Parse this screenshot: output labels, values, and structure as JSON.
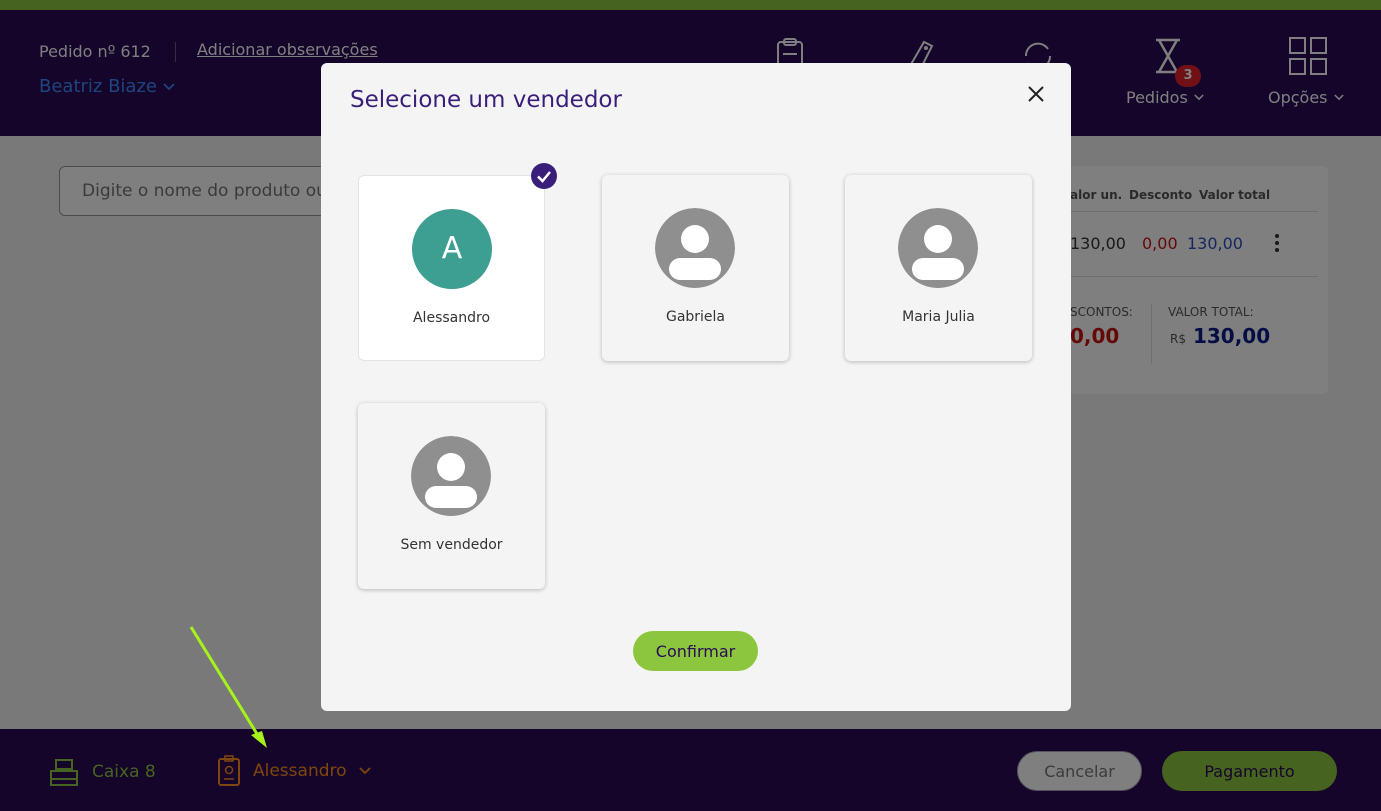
{
  "header": {
    "order_label": "Pedido nº 612",
    "add_notes": "Adicionar observações",
    "customer": "Beatriz Biaze",
    "nav": [
      {
        "label": "Pedidos",
        "icon": "hourglass-icon",
        "badge": "3"
      },
      {
        "label": "Opções",
        "icon": "grid-icon"
      }
    ]
  },
  "search": {
    "placeholder": "Digite o nome do produto ou código"
  },
  "cart": {
    "columns": [
      "alor un.",
      "Desconto",
      "Valor total"
    ],
    "row": {
      "unit": "130,00",
      "discount": "0,00",
      "total": "130,00"
    },
    "discounts_label": "SCONTOS:",
    "discounts_value": "0,00",
    "total_label": "VALOR TOTAL:",
    "currency": "R$",
    "total_value": "130,00"
  },
  "footer": {
    "register": "Caixa 8",
    "seller": "Alessandro",
    "cancel": "Cancelar",
    "payment": "Pagamento"
  },
  "modal": {
    "title": "Selecione um vendedor",
    "sellers": [
      {
        "name": "Alessandro",
        "initial": "A",
        "selected": true
      },
      {
        "name": "Gabriela"
      },
      {
        "name": "Maria Julia"
      },
      {
        "name": "Sem vendedor"
      }
    ],
    "confirm": "Confirmar"
  },
  "colors": {
    "brand_purple": "#2a0a55",
    "accent_green": "#8cc63f",
    "seller_orange": "#ff8c1a",
    "avatar_teal": "#3d9e92",
    "discount_red": "#cc1111",
    "total_navy": "#0a1a8a"
  }
}
